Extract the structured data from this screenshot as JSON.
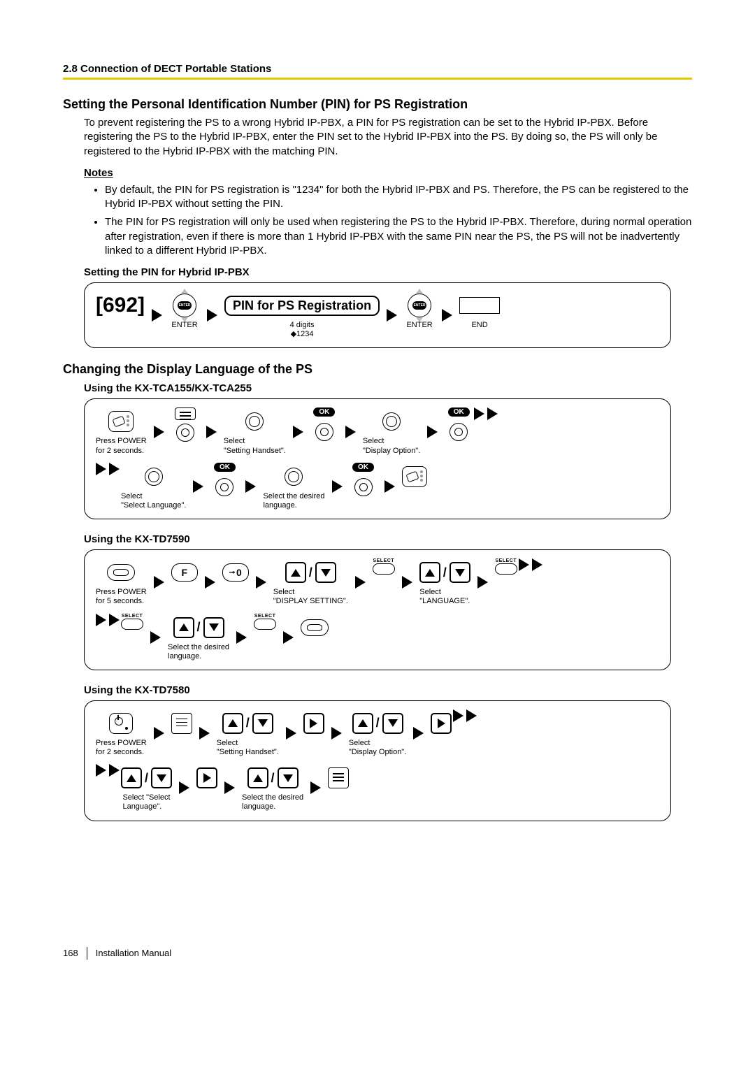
{
  "header": {
    "section": "2.8 Connection of DECT Portable Stations"
  },
  "pin": {
    "title": "Setting the Personal Identification Number (PIN) for PS Registration",
    "body": "To prevent registering the PS to a wrong Hybrid IP-PBX, a PIN for PS registration can be set to the Hybrid IP-PBX. Before registering the PS to the Hybrid IP-PBX, enter the PIN set to the Hybrid IP-PBX into the PS. By doing so, the PS will only be registered to the Hybrid IP-PBX with the matching PIN.",
    "notes_hdr": "Notes",
    "notes": [
      "By default, the PIN for PS registration is \"1234\" for both the Hybrid IP-PBX and PS. Therefore, the PS can be registered to the Hybrid IP-PBX without setting the PIN.",
      "The PIN for PS registration will only be used when registering the PS to the Hybrid IP-PBX. Therefore, during normal operation after registration, even if there is more than 1 Hybrid IP-PBX with the same PIN near the PS, the PS will not be inadvertently linked to a different Hybrid IP-PBX."
    ],
    "proc_hdr": "Setting the PIN for Hybrid IP-PBX",
    "proc": {
      "code": "[692]",
      "enter1": "ENTER",
      "pill": "PIN for PS Registration",
      "digits": "4 digits",
      "default": "◆1234",
      "enter2": "ENTER",
      "end": "END"
    }
  },
  "lang": {
    "title": "Changing the Display Language of the PS",
    "tca": {
      "hdr": "Using the KX-TCA155/KX-TCA255",
      "s1": "Press POWER\nfor 2 seconds.",
      "s2": "Select\n\"Setting Handset\".",
      "s3": "Select\n\"Display Option\".",
      "s4": "Select\n\"Select Language\".",
      "s5": "Select the desired\nlanguage.",
      "ok": "OK"
    },
    "td7590": {
      "hdr": "Using the KX-TD7590",
      "s1": "Press POWER\nfor 5 seconds.",
      "f": "F",
      "zero": "0",
      "s2": "Select\n\"DISPLAY SETTING\".",
      "s3": "Select\n\"LANGUAGE\".",
      "s4": "Select the desired\nlanguage.",
      "select": "SELECT"
    },
    "td7580": {
      "hdr": "Using the KX-TD7580",
      "s1": "Press POWER\nfor 2 seconds.",
      "s2": "Select\n\"Setting Handset\".",
      "s3": "Select\n\"Display Option\".",
      "s4": "Select \"Select\nLanguage\".",
      "s5": "Select the desired\nlanguage."
    }
  },
  "footer": {
    "page": "168",
    "label": "Installation Manual"
  }
}
